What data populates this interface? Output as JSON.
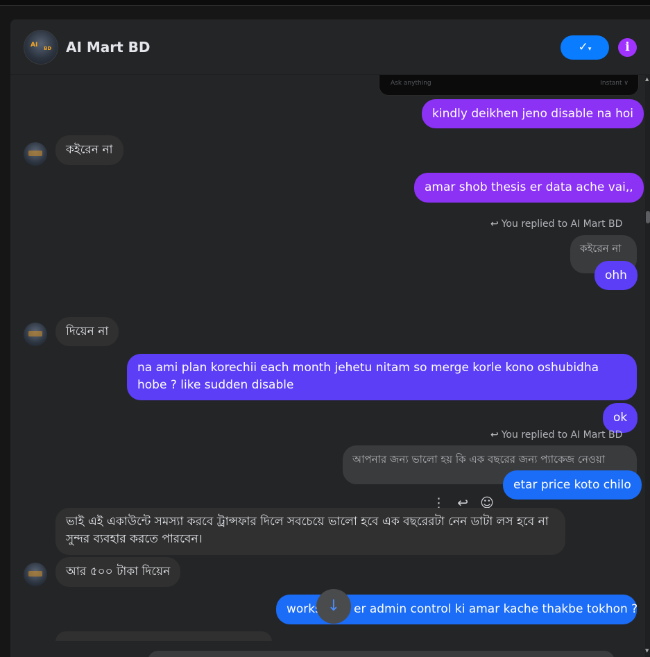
{
  "header": {
    "title": "AI Mart BD",
    "avatar_text": "AI Mart BD",
    "check_label": "✓",
    "check_chevron": "▾",
    "info_label": "i"
  },
  "preview": {
    "left": "Ask anything",
    "right": "Instant ∨"
  },
  "messages": {
    "m1": "kindly deikhen jeno disable na hoi",
    "m2": "কইরেন না",
    "m3": "amar shob thesis er data ache vai,,",
    "reply1_note": "You replied to AI Mart BD",
    "reply1_quote": "কইরেন না",
    "m4": "ohh",
    "m5": "দিয়েন না",
    "m6": "na ami plan korechii each month jehetu nitam so merge korle kono oshubidha hobe ? like sudden disable",
    "m7": "ok",
    "reply2_note": "You replied to AI Mart BD",
    "reply2_quote": "আপনার জন্য ভালো হয় কি এক বছরের জন্য প্যাকেজ নেওয়া",
    "m8": "etar price koto chilo",
    "m9": "ভাই এই একাউন্টে সমস্যা করবে ট্রান্সফার দিলে সবচেয়ে ভালো হবে এক বছরেরটা নেন ডাটা লস হবে না সুন্দর ব্যবহার করতে পারবেন।",
    "m10": "আর ৫০০ টাকা দিয়েন",
    "m11": "works",
    "m11b": "er admin control ki amar kache thakbe tokhon ?"
  },
  "icons": {
    "reply": "reply-icon",
    "more": "more-vertical-icon",
    "emoji": "emoji-icon",
    "scroll_down": "arrow-down-icon"
  },
  "colors": {
    "accent_blue": "#0a7cff",
    "purple": "#8b32f5",
    "violet": "#5b3ef5",
    "info": "#a033ff"
  }
}
